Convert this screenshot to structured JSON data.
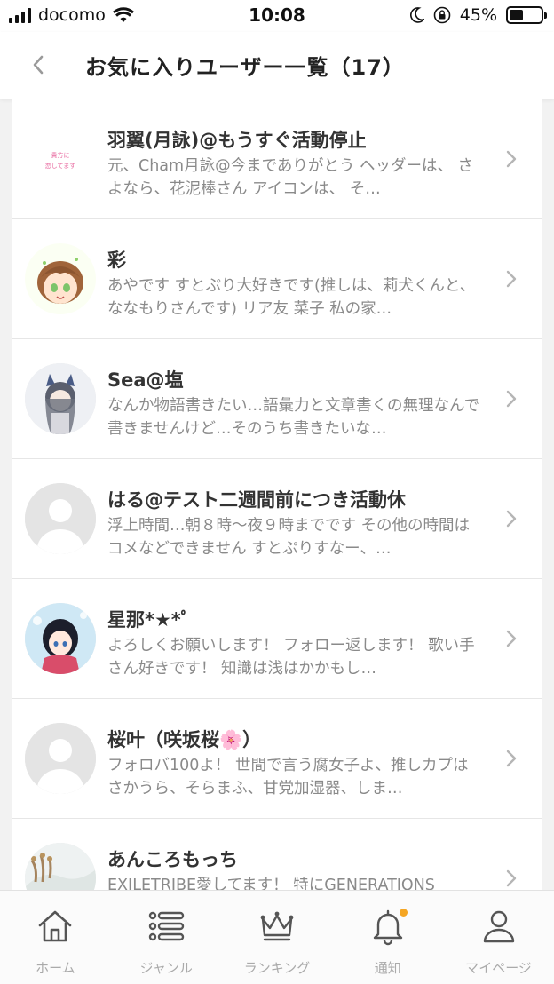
{
  "status_bar": {
    "carrier": "docomo",
    "time": "10:08",
    "battery": "45%",
    "battery_level": 0.45
  },
  "header": {
    "title": "お気に入りユーザー一覧（17）"
  },
  "users": [
    {
      "name": "羽翼(月詠)@もうすぐ活動停止",
      "desc": "元、Cham月詠@今までありがとう ヘッダーは、 さよなら、花泥棒さん アイコンは、 そ…",
      "avatar": "text-image",
      "avatar_text_1": "貴方に",
      "avatar_text_2": "恋してます"
    },
    {
      "name": "彩",
      "desc": "あやです すとぷり大好きです(推しは、莉犬くんと、ななもりさんです) リア友 菜子 私の家…",
      "avatar": "anime-boy"
    },
    {
      "name": "Sea@塩",
      "desc": "なんか物語書きたい…語彙力と文章書くの無理なんで書きませんけど…そのうち書きたいな…",
      "avatar": "anime-girl-cat"
    },
    {
      "name": "はる@テスト二週間前につき活動休",
      "desc": "浮上時間…朝８時～夜９時までです その他の時間はコメなどできません すとぷりすなー、…",
      "avatar": "default-user"
    },
    {
      "name": "星那*★*ﾟ",
      "desc": "よろしくお願いします！ フォロー返します！ 歌い手さん好きです！ 知識は浅はかかもし…",
      "avatar": "anime-girl"
    },
    {
      "name": "桜叶（咲坂桜🌸）",
      "desc": "フォロバ100よ！ 世間で言う腐女子よ、推しカプはさかうら、そらまふ、甘党加湿器、しま…",
      "avatar": "default-user"
    },
    {
      "name": "あんころもっち",
      "desc": "EXILETRIBE愛してます！ 特にGENERATIONS",
      "avatar": "photo"
    }
  ],
  "tabs": [
    {
      "label": "ホーム",
      "icon": "home-icon"
    },
    {
      "label": "ジャンル",
      "icon": "list-icon"
    },
    {
      "label": "ランキング",
      "icon": "crown-icon"
    },
    {
      "label": "通知",
      "icon": "bell-icon",
      "badge": true
    },
    {
      "label": "マイページ",
      "icon": "user-icon"
    }
  ],
  "colors": {
    "accent_badge": "#f5a623",
    "tab_icon": "#555555",
    "tab_label": "#aaaaaa",
    "desc_text": "#8a8a8a"
  }
}
